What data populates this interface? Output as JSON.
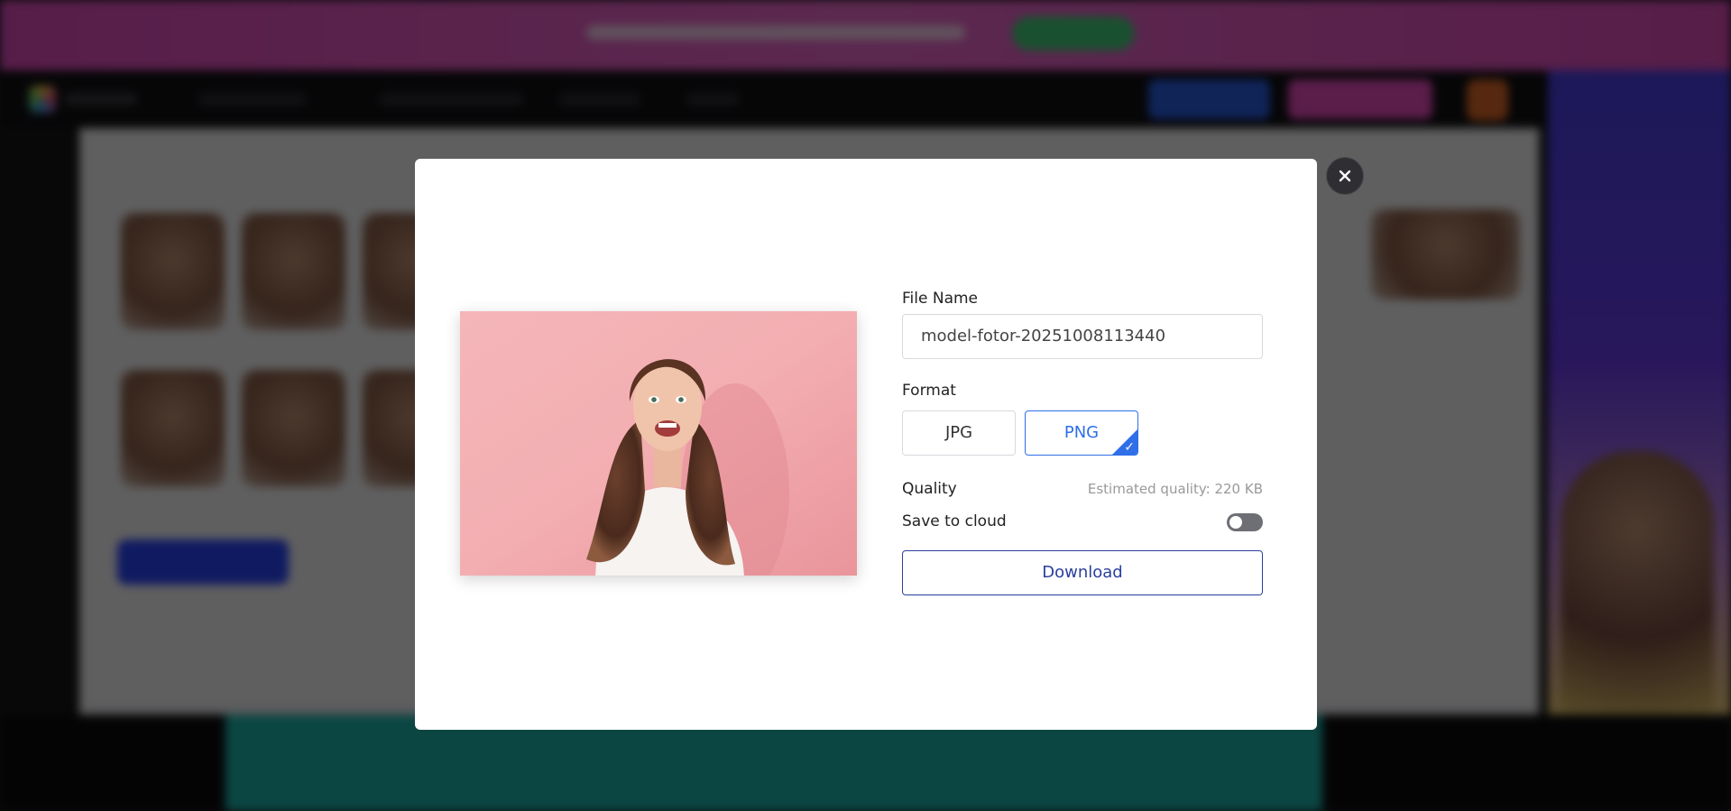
{
  "dialog": {
    "close_icon": "close-icon",
    "file_name_label": "File Name",
    "file_name_value": "model-fotor-20251008113440",
    "format_label": "Format",
    "formats": [
      "JPG",
      "PNG"
    ],
    "selected_format": "PNG",
    "quality_label": "Quality",
    "quality_estimate": "Estimated quality: 220 KB",
    "save_to_cloud_label": "Save to cloud",
    "save_to_cloud_enabled": false,
    "download_label": "Download",
    "accent_color": "#2f6fe8",
    "download_color": "#2a3f9e"
  }
}
